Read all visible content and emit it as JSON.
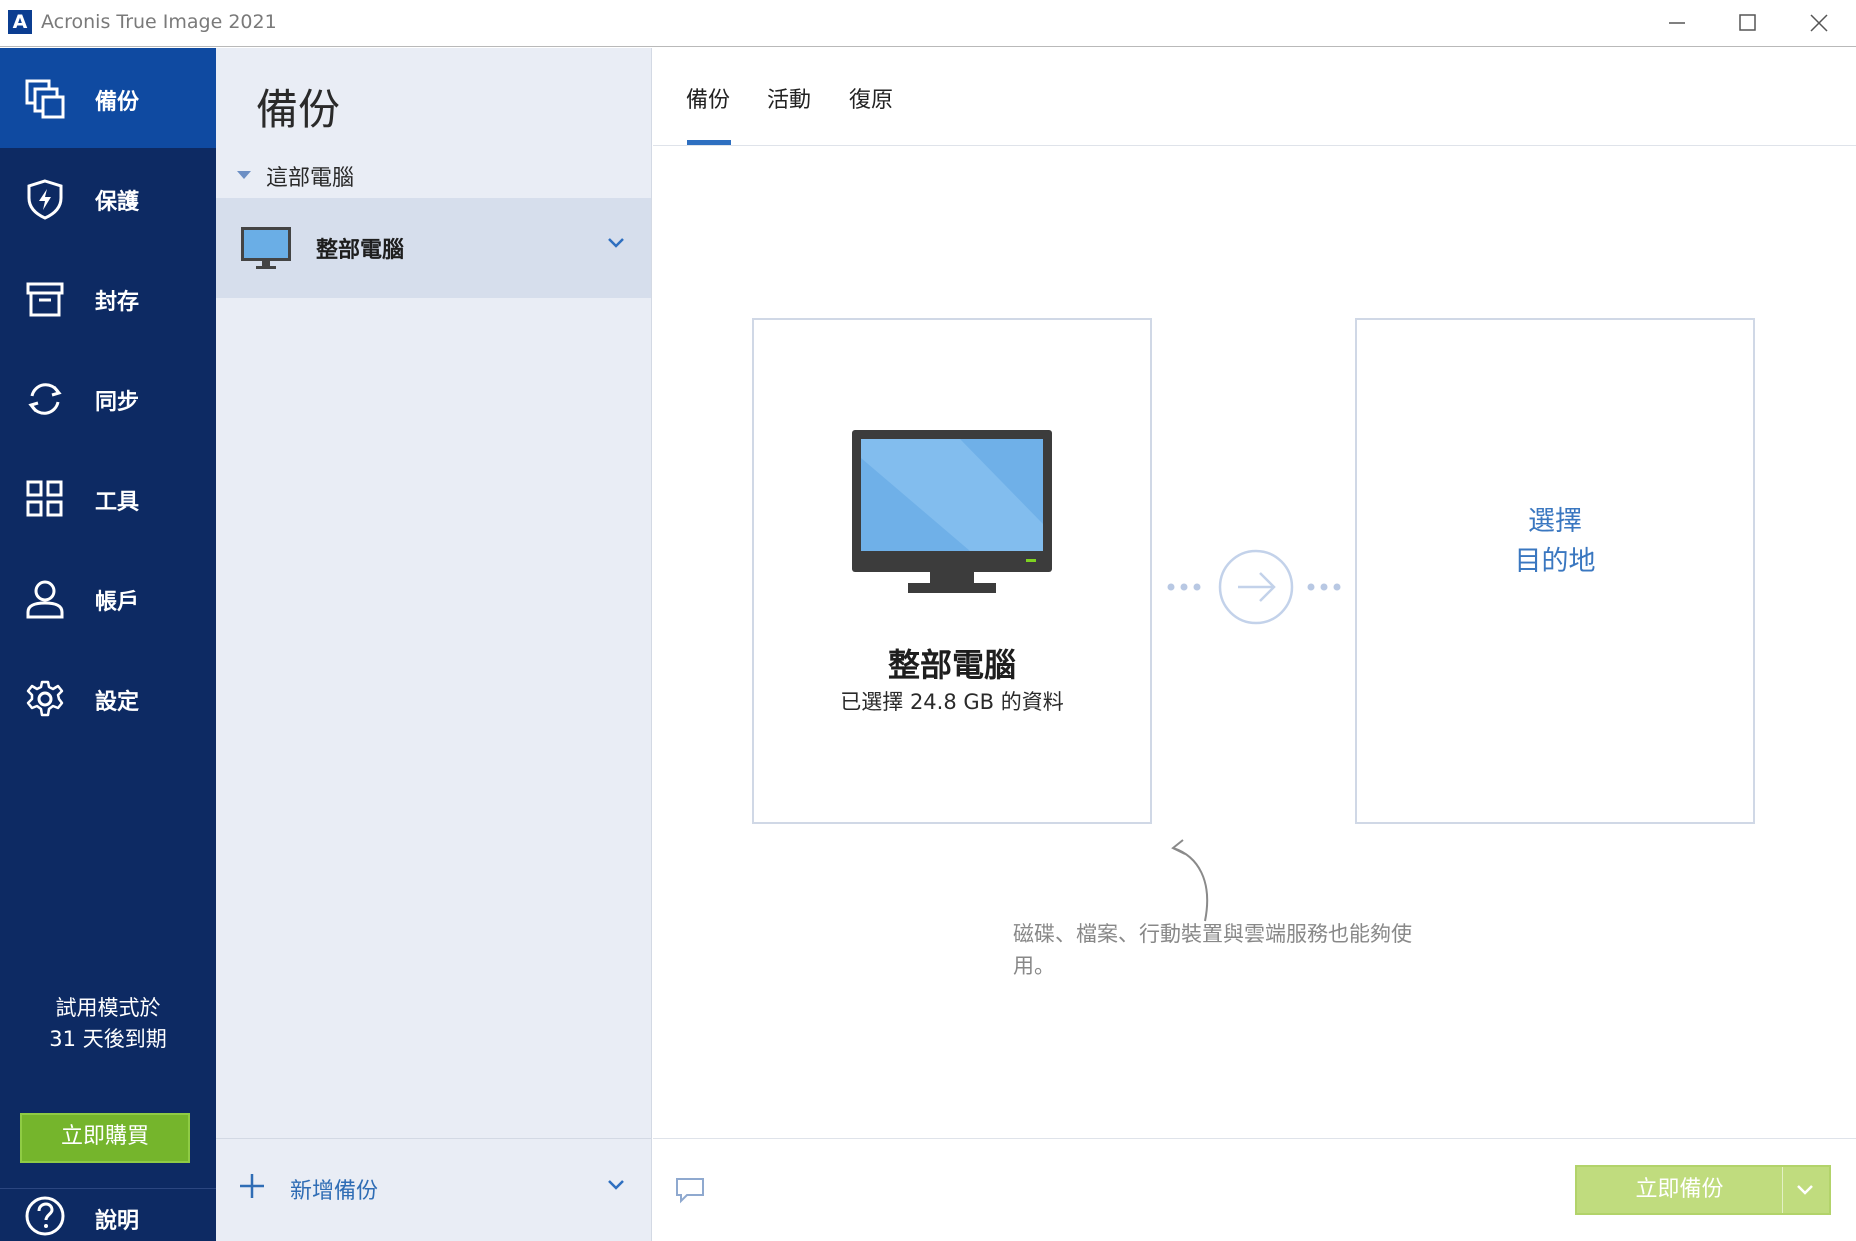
{
  "window": {
    "title": "Acronis True Image 2021",
    "logo_letter": "A"
  },
  "sidebar": {
    "items": [
      {
        "label": "備份",
        "icon": "backup-icon",
        "active": true
      },
      {
        "label": "保護",
        "icon": "shield-icon"
      },
      {
        "label": "封存",
        "icon": "archive-icon"
      },
      {
        "label": "同步",
        "icon": "sync-icon"
      },
      {
        "label": "工具",
        "icon": "tools-grid-icon"
      },
      {
        "label": "帳戶",
        "icon": "account-icon"
      },
      {
        "label": "設定",
        "icon": "gear-icon"
      }
    ],
    "trial_line1": "試用模式於",
    "trial_line2": "31 天後到期",
    "buy_label": "立即購買",
    "help_label": "說明"
  },
  "backup_list": {
    "title": "備份",
    "group_label": "這部電腦",
    "source_item_label": "整部電腦",
    "add_label": "新增備份"
  },
  "tabs": [
    "備份",
    "活動",
    "復原"
  ],
  "source_card": {
    "title": "整部電腦",
    "subtitle": "已選擇 24.8 GB 的資料"
  },
  "destination_card": {
    "line1": "選擇",
    "line2": "目的地"
  },
  "hint": "磁碟、檔案、行動裝置與雲端服務也能夠使用。",
  "footer": {
    "backup_now_label": "立即備份"
  },
  "colors": {
    "sidebar_bg": "#0d2a63",
    "sidebar_active": "#0f4aa1",
    "accent_blue": "#2e6fc0",
    "buy_green": "#75b52c",
    "backup_btn_disabled": "#c0dc7e"
  }
}
